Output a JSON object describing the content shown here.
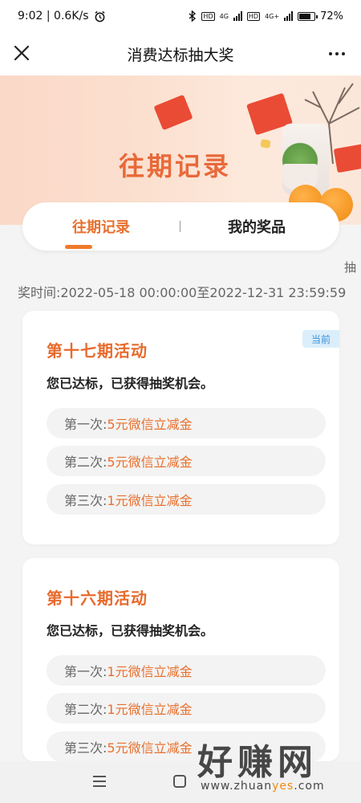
{
  "status_bar": {
    "time_speed": "9:02 | 0.6K/s",
    "network_1": "4G",
    "network_2": "4G+",
    "hd": "HD",
    "battery": "72%"
  },
  "header": {
    "title": "消费达标抽大奖"
  },
  "tabs": [
    {
      "label": "往期记录",
      "active": true
    },
    {
      "label": "我的奖品",
      "active": false
    }
  ],
  "banner": {
    "title": "往期记录"
  },
  "side_text": "抽",
  "time_range": "奖时间:2022-05-18 00:00:00至2022-12-31 23:59:59",
  "campaigns": [
    {
      "title": "第十七期活动",
      "badge": "当前",
      "status": "您已达标，已获得抽奖机会。",
      "draws": [
        {
          "label": "第一次:",
          "prize": "5元微信立减金"
        },
        {
          "label": "第二次:",
          "prize": "5元微信立减金"
        },
        {
          "label": "第三次:",
          "prize": "1元微信立减金"
        }
      ]
    },
    {
      "title": "第十六期活动",
      "status": "您已达标，已获得抽奖机会。",
      "draws": [
        {
          "label": "第一次:",
          "prize": "1元微信立减金"
        },
        {
          "label": "第二次:",
          "prize": "1元微信立减金"
        },
        {
          "label": "第三次:",
          "prize": "5元微信立减金"
        }
      ]
    }
  ],
  "watermark": {
    "main": "好赚网",
    "url_a": "www.zhuan",
    "url_b": "yes",
    "url_c": ".com"
  },
  "colors": {
    "accent": "#e8702e",
    "badge_bg": "#dbeefb",
    "badge_text": "#3a8fd8"
  }
}
